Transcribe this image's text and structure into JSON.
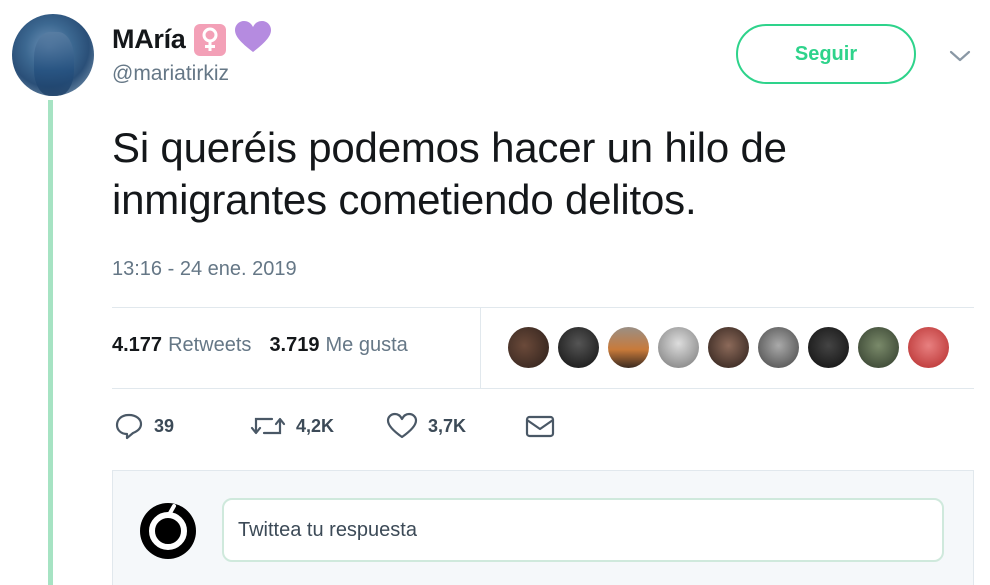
{
  "tweet": {
    "author": {
      "display_name": "MAría",
      "handle": "@mariatirkiz",
      "badges": [
        "female-sign-icon",
        "purple-heart-icon"
      ]
    },
    "follow_button": "Seguir",
    "text": "Si queréis podemos hacer un hilo de inmigrantes cometiendo delitos.",
    "timestamp": "13:16 - 24 ene. 2019",
    "stats": {
      "retweets_count": "4.177",
      "retweets_label": "Retweets",
      "likes_count": "3.719",
      "likes_label": "Me gusta"
    },
    "likers_count_shown": 9,
    "actions": {
      "replies": "39",
      "retweets": "4,2K",
      "likes": "3,7K"
    }
  },
  "reply": {
    "placeholder": "Twittea tu respuesta"
  },
  "colors": {
    "accent_green": "#2ed38b",
    "thread_line": "#a6e3c3",
    "muted_text": "#657786",
    "badge_pink": "#f3a0b7",
    "heart_purple": "#b58be0"
  }
}
